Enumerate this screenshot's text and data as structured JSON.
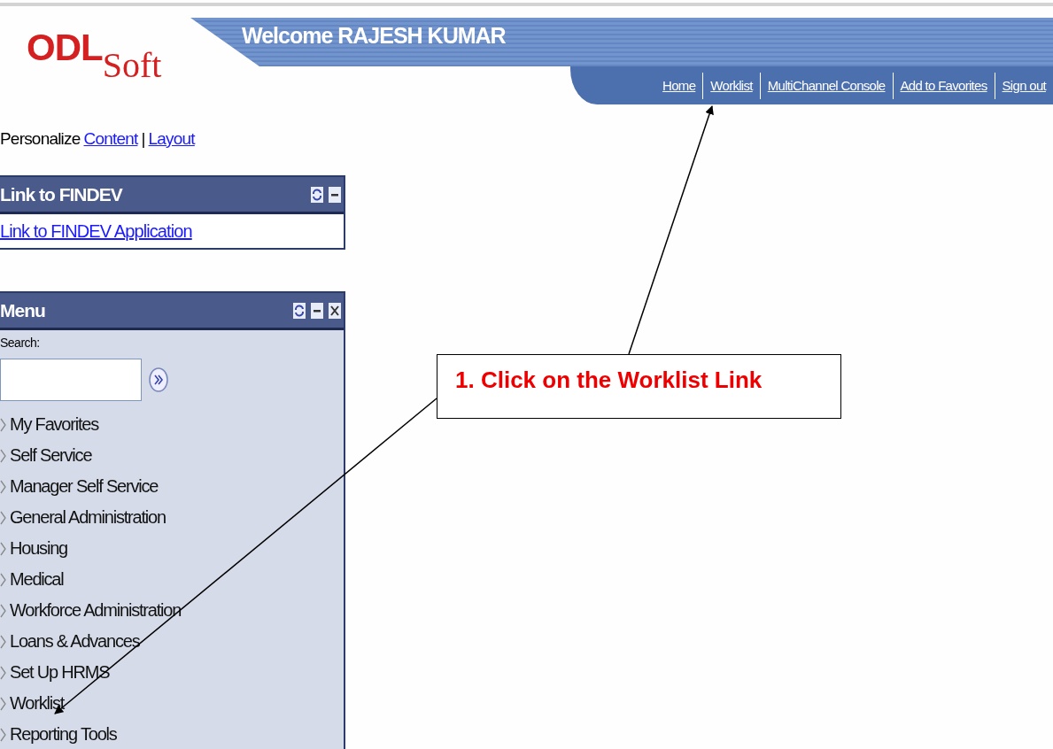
{
  "logo": {
    "main": "ODL",
    "sub": "Soft"
  },
  "welcome": "Welcome RAJESH KUMAR",
  "nav_links": [
    "Home",
    "Worklist",
    "MultiChannel Console",
    "Add to Favorites",
    "Sign out"
  ],
  "personalize": {
    "label": "Personalize",
    "links": [
      "Content",
      "Layout"
    ],
    "separator": "|"
  },
  "findev_panel": {
    "title": "Link to FINDEV",
    "link": "Link to FINDEV Application"
  },
  "menu_panel": {
    "title": "Menu",
    "search_label": "Search:",
    "items": [
      "My Favorites",
      "Self Service",
      "Manager Self Service",
      "General Administration",
      "Housing",
      "Medical",
      "Workforce Administration",
      "Loans & Advances",
      "Set Up HRMS",
      "Worklist",
      "Reporting Tools"
    ]
  },
  "callout": {
    "text": "1. Click on the Worklist Link"
  }
}
